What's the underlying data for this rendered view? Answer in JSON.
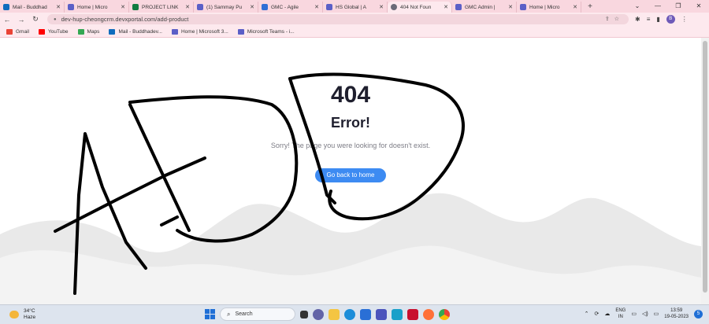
{
  "browser": {
    "tabs": [
      {
        "title": "Mail - Buddhad",
        "color": "#0f6cbd"
      },
      {
        "title": "Home | Micro",
        "color": "#5b5fc7"
      },
      {
        "title": "PROJECT LINK",
        "color": "#107c41"
      },
      {
        "title": "(1) Sammay Pu",
        "color": "#5b5fc7"
      },
      {
        "title": "GMC - Agile",
        "color": "#2f6fd6"
      },
      {
        "title": "HS Global | A",
        "color": "#5b5fc7"
      },
      {
        "title": "404 Not Foun",
        "color": "#6b6b78",
        "active": true
      },
      {
        "title": "GMC Admin |",
        "color": "#5b5fc7"
      },
      {
        "title": "Home | Micro",
        "color": "#5b5fc7"
      }
    ],
    "new_tab": "+",
    "url": "dev-hup-cheongcrm.devxportal.com/add-product",
    "profile_initial": "B"
  },
  "bookmarks": [
    {
      "label": "Gmail",
      "color": "#ea4335"
    },
    {
      "label": "YouTube",
      "color": "#ff0000"
    },
    {
      "label": "Maps",
      "color": "#34a853"
    },
    {
      "label": "Mail - Buddhadev...",
      "color": "#0f6cbd"
    },
    {
      "label": "Home | Microsoft 3...",
      "color": "#5b5fc7"
    },
    {
      "label": "Microsoft Teams - i...",
      "color": "#5b5fc7"
    }
  ],
  "page": {
    "code": "404",
    "title": "Error!",
    "message": "Sorry! The page you were looking for doesn't exist.",
    "button": "Go back to home"
  },
  "taskbar": {
    "temperature": "34°C",
    "condition": "Haze",
    "search_label": "Search",
    "lang_top": "ENG",
    "lang_bottom": "IN",
    "time": "13:59",
    "date": "19-05-2023",
    "notifications": "5"
  },
  "colors": {
    "tab_strip": "#f9d7df",
    "button": "#3d8bf2",
    "text_dark": "#1f1f2e"
  }
}
